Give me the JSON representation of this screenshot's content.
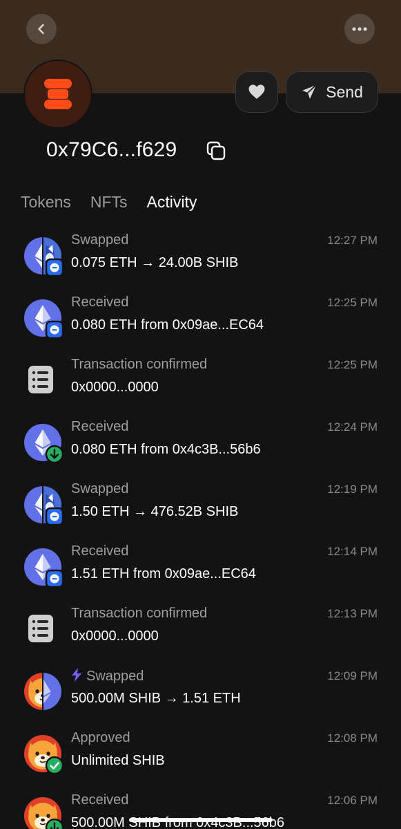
{
  "header": {
    "address": "0x79C6...f629",
    "send_label": "Send"
  },
  "tabs": [
    {
      "label": "Tokens",
      "active": false
    },
    {
      "label": "NFTs",
      "active": false
    },
    {
      "label": "Activity",
      "active": true
    }
  ],
  "activity": [
    {
      "title": "Swapped",
      "subtitle": "0.075 ETH → 24.00B SHIB",
      "time": "12:27 PM",
      "icon": "eth-shib-swap-icon",
      "badge": "swap-badge-icon"
    },
    {
      "title": "Received",
      "subtitle": "0.080 ETH from 0x09ae...EC64",
      "time": "12:25 PM",
      "icon": "eth-token-icon",
      "badge": "swap-badge-icon"
    },
    {
      "title": "Transaction confirmed",
      "subtitle": "0x0000...0000",
      "time": "12:25 PM",
      "icon": "list-icon",
      "badge": ""
    },
    {
      "title": "Received",
      "subtitle": "0.080 ETH from 0x4c3B...56b6",
      "time": "12:24 PM",
      "icon": "eth-token-icon",
      "badge": "receive-badge-icon"
    },
    {
      "title": "Swapped",
      "subtitle": "1.50 ETH → 476.52B SHIB",
      "time": "12:19 PM",
      "icon": "eth-shib-swap-icon",
      "badge": "swap-badge-icon"
    },
    {
      "title": "Received",
      "subtitle": "1.51 ETH from 0x09ae...EC64",
      "time": "12:14 PM",
      "icon": "eth-token-icon",
      "badge": "swap-badge-icon"
    },
    {
      "title": "Transaction confirmed",
      "subtitle": "0x0000...0000",
      "time": "12:13 PM",
      "icon": "list-icon",
      "badge": ""
    },
    {
      "title": "Swapped",
      "subtitle": "500.00M SHIB → 1.51 ETH",
      "time": "12:09 PM",
      "icon": "shib-eth-swap-icon",
      "badge": "",
      "bolt": true
    },
    {
      "title": "Approved",
      "subtitle": "Unlimited SHIB",
      "time": "12:08 PM",
      "icon": "shib-token-icon",
      "badge": "check-badge-icon"
    },
    {
      "title": "Received",
      "subtitle": "500.00M SHIB from 0x4c3B...56b6",
      "time": "12:06 PM",
      "icon": "shib-token-icon",
      "badge": "receive-badge-icon"
    }
  ],
  "colors": {
    "background": "#131313",
    "banner": "#3b2a1e",
    "eth_purple": "#6271e8",
    "badge_blue": "#2b6bf3",
    "badge_green": "#27ae60",
    "bolt_purple": "#7b5cff",
    "avatar_orange": "#ff4d1a"
  }
}
